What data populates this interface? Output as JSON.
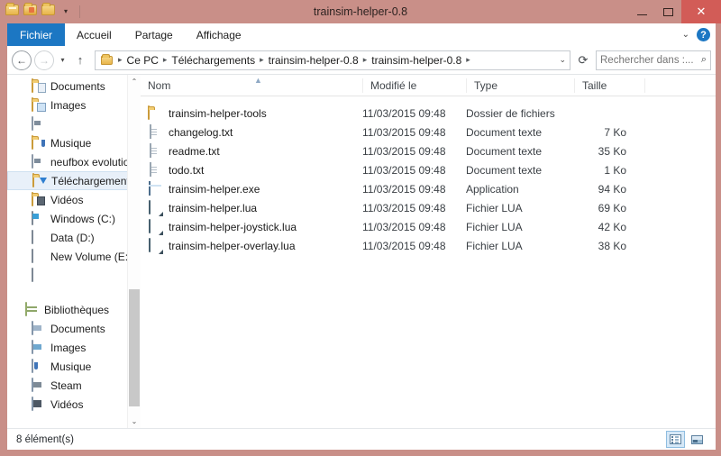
{
  "window": {
    "title": "trainsim-helper-0.8",
    "accent_titlebar": "#c98f88",
    "close_color": "#d25c57",
    "quick_access": [
      {
        "name": "folder-properties-icon",
        "label": "Propriétés"
      },
      {
        "name": "new-folder-icon",
        "label": "Nouveau dossier"
      },
      {
        "name": "customize-icon",
        "label": "Personnaliser"
      }
    ],
    "controls": {
      "minimize": "–",
      "maximize": "□",
      "close": "✕"
    }
  },
  "ribbon": {
    "tabs": [
      {
        "label": "Fichier",
        "active": true
      },
      {
        "label": "Accueil",
        "active": false
      },
      {
        "label": "Partage",
        "active": false
      },
      {
        "label": "Affichage",
        "active": false
      }
    ],
    "collapse_icon": "⌄",
    "help_label": "?"
  },
  "address": {
    "back": "←",
    "forward": "→",
    "history": "⌄",
    "up": "↑",
    "breadcrumbs": [
      "Ce PC",
      "Téléchargements",
      "trainsim-helper-0.8",
      "trainsim-helper-0.8"
    ],
    "separator": "▸",
    "dropdown_caret": "⌄",
    "refresh": "⟳",
    "search_placeholder": "Rechercher dans :...",
    "search_value": "",
    "search_icon": "⌕"
  },
  "sidebar": {
    "items": [
      {
        "label": "Documents",
        "icon": "folder-documents-icon",
        "indent": 1,
        "selected": false
      },
      {
        "label": "Images",
        "icon": "folder-pictures-icon",
        "indent": 1,
        "selected": false
      },
      {
        "label": "",
        "icon": "network-folder-icon",
        "indent": 1,
        "selected": false
      },
      {
        "label": "Musique",
        "icon": "folder-music-icon",
        "indent": 1,
        "selected": false
      },
      {
        "label": "neufbox evolution",
        "icon": "network-folder-icon",
        "indent": 1,
        "selected": false
      },
      {
        "label": "Téléchargements",
        "icon": "folder-downloads-icon",
        "indent": 1,
        "selected": true
      },
      {
        "label": "Vidéos",
        "icon": "folder-videos-icon",
        "indent": 1,
        "selected": false
      },
      {
        "label": "Windows (C:)",
        "icon": "drive-windows-icon",
        "indent": 1,
        "selected": false
      },
      {
        "label": "Data (D:)",
        "icon": "drive-icon",
        "indent": 1,
        "selected": false
      },
      {
        "label": "New Volume (E:)",
        "icon": "drive-icon",
        "indent": 1,
        "selected": false
      },
      {
        "label": "",
        "icon": "drive-icon",
        "indent": 1,
        "selected": false
      }
    ],
    "libraries_header": {
      "label": "Bibliothèques",
      "icon": "libraries-icon"
    },
    "libraries": [
      {
        "label": "Documents",
        "icon": "library-documents-icon"
      },
      {
        "label": "Images",
        "icon": "library-pictures-icon"
      },
      {
        "label": "Musique",
        "icon": "library-music-icon"
      },
      {
        "label": "Steam",
        "icon": "library-steam-icon"
      },
      {
        "label": "Vidéos",
        "icon": "library-videos-icon"
      }
    ],
    "scroll_up": "⌃",
    "scroll_down": "⌄"
  },
  "filelist": {
    "columns": [
      "Nom",
      "Modifié le",
      "Type",
      "Taille"
    ],
    "sort_column": "Nom",
    "sort_indicator": "▲",
    "rows": [
      {
        "name": "trainsim-helper-tools",
        "modified": "11/03/2015 09:48",
        "type": "Dossier de fichiers",
        "size": "",
        "icon": "folder-icon"
      },
      {
        "name": "changelog.txt",
        "modified": "11/03/2015 09:48",
        "type": "Document texte",
        "size": "7 Ko",
        "icon": "text-file-icon"
      },
      {
        "name": "readme.txt",
        "modified": "11/03/2015 09:48",
        "type": "Document texte",
        "size": "35 Ko",
        "icon": "text-file-icon"
      },
      {
        "name": "todo.txt",
        "modified": "11/03/2015 09:48",
        "type": "Document texte",
        "size": "1 Ko",
        "icon": "text-file-icon"
      },
      {
        "name": "trainsim-helper.exe",
        "modified": "11/03/2015 09:48",
        "type": "Application",
        "size": "94 Ko",
        "icon": "application-icon"
      },
      {
        "name": "trainsim-helper.lua",
        "modified": "11/03/2015 09:48",
        "type": "Fichier LUA",
        "size": "69 Ko",
        "icon": "lua-file-icon"
      },
      {
        "name": "trainsim-helper-joystick.lua",
        "modified": "11/03/2015 09:48",
        "type": "Fichier LUA",
        "size": "42 Ko",
        "icon": "lua-file-icon"
      },
      {
        "name": "trainsim-helper-overlay.lua",
        "modified": "11/03/2015 09:48",
        "type": "Fichier LUA",
        "size": "38 Ko",
        "icon": "lua-file-icon"
      }
    ]
  },
  "statusbar": {
    "text": "8 élément(s)",
    "views": [
      {
        "name": "details-view-button",
        "active": true
      },
      {
        "name": "large-icons-view-button",
        "active": false
      }
    ]
  }
}
